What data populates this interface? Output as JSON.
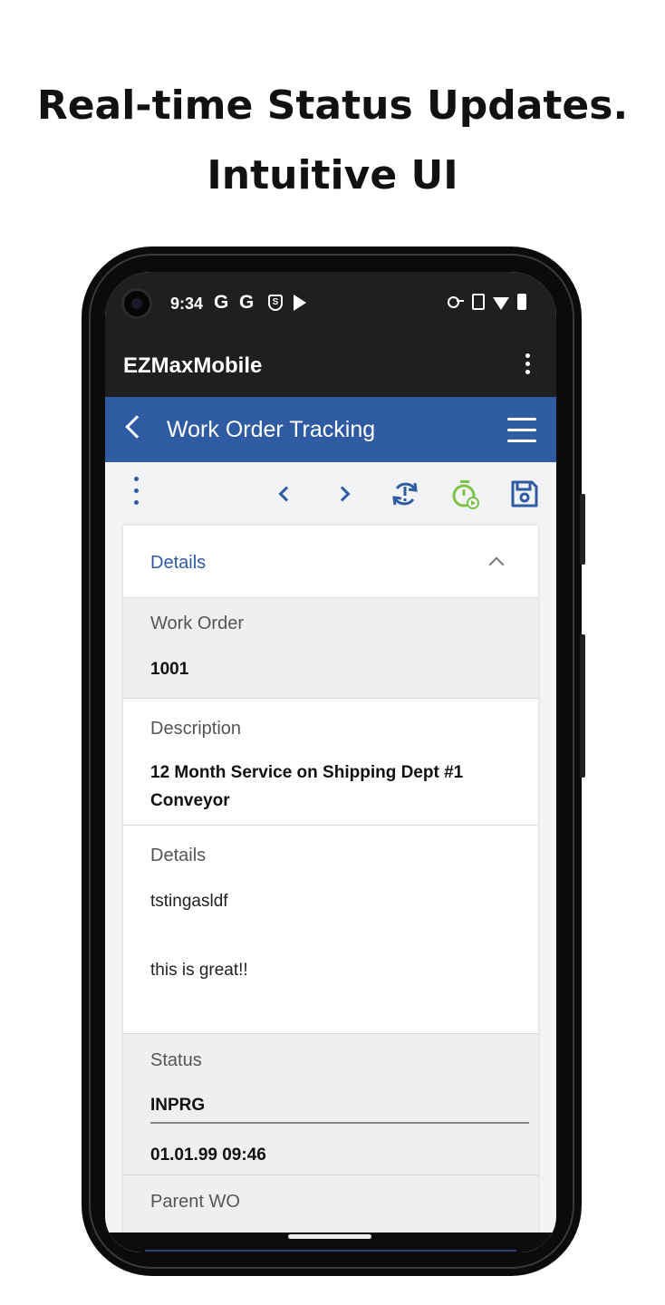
{
  "headline": {
    "line1": "Real-time Status Updates.",
    "line2": "Intuitive UI"
  },
  "statusbar": {
    "time": "9:34",
    "g1": "G",
    "g2": "G",
    "s_badge": "S"
  },
  "appbar": {
    "title": "EZMaxMobile"
  },
  "header": {
    "title": "Work Order Tracking"
  },
  "section": {
    "title": "Details"
  },
  "fields": {
    "work_order": {
      "label": "Work Order",
      "value": "1001"
    },
    "description": {
      "label": "Description",
      "value": "12 Month Service on Shipping Dept #1 Conveyor"
    },
    "details": {
      "label": "Details",
      "line1": "tstingasldf",
      "line2": "this is great!!"
    },
    "status": {
      "label": "Status",
      "value": "INPRG",
      "date": "01.01.99 09:46"
    },
    "parent_wo": {
      "label": "Parent WO"
    }
  },
  "colors": {
    "accent": "#2f5ba3",
    "timer_green": "#7cc24a",
    "appbar": "#1f1f1f"
  }
}
